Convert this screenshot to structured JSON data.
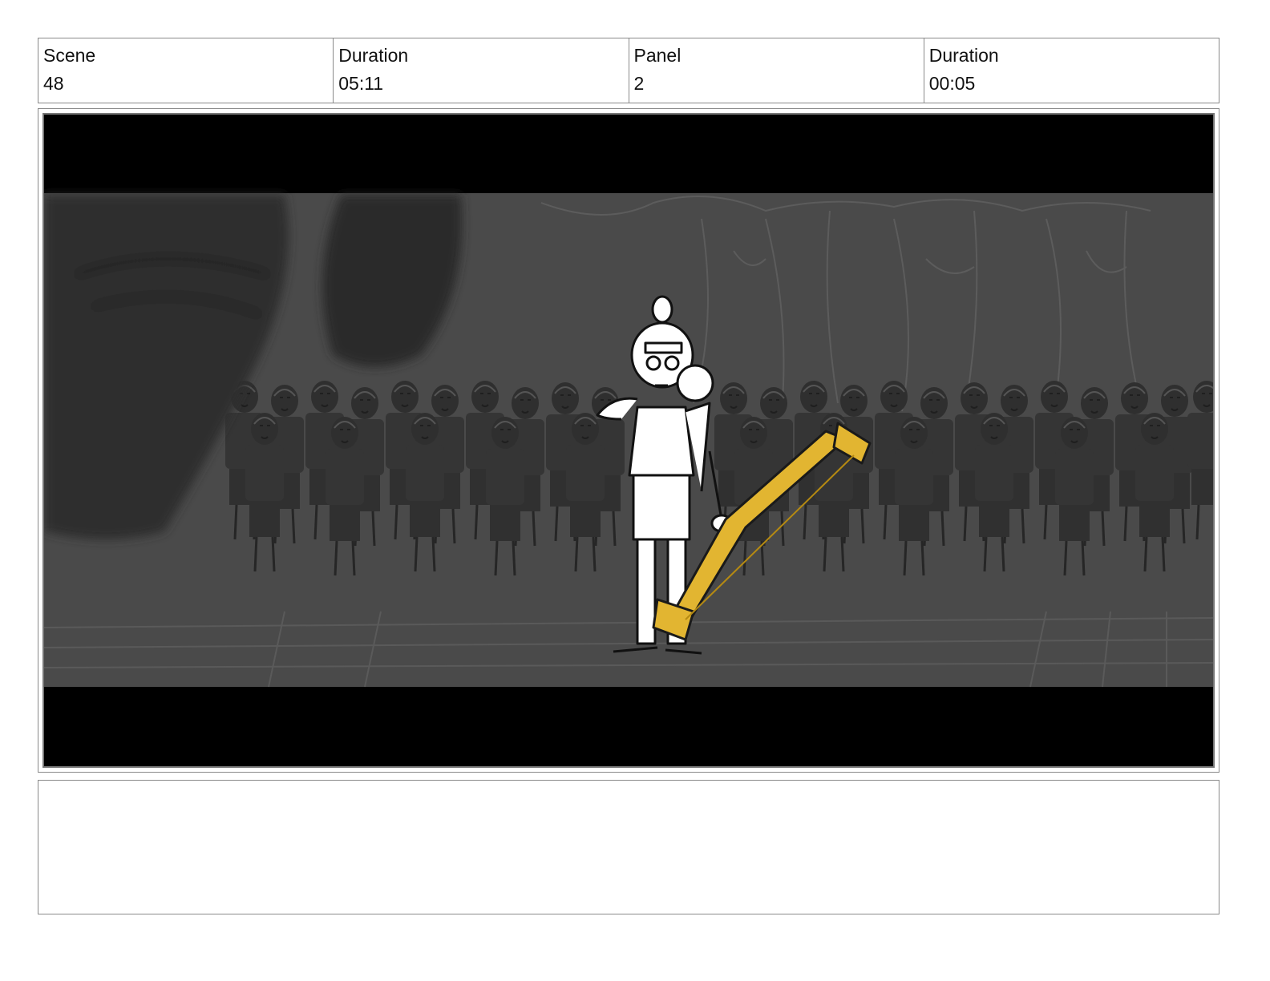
{
  "header": {
    "scene_label": "Scene",
    "scene_value": "48",
    "scene_duration_label": "Duration",
    "scene_duration_value": "05:11",
    "panel_label": "Panel",
    "panel_value": "2",
    "panel_duration_label": "Duration",
    "panel_duration_value": "00:05"
  },
  "panel": {
    "colors": {
      "letterbox": "#000000",
      "background": "#4a4a4a",
      "crowd": "#3b3b3b",
      "character": "#ffffff",
      "weapon": "#e2b531"
    }
  },
  "notes": {
    "text": ""
  }
}
